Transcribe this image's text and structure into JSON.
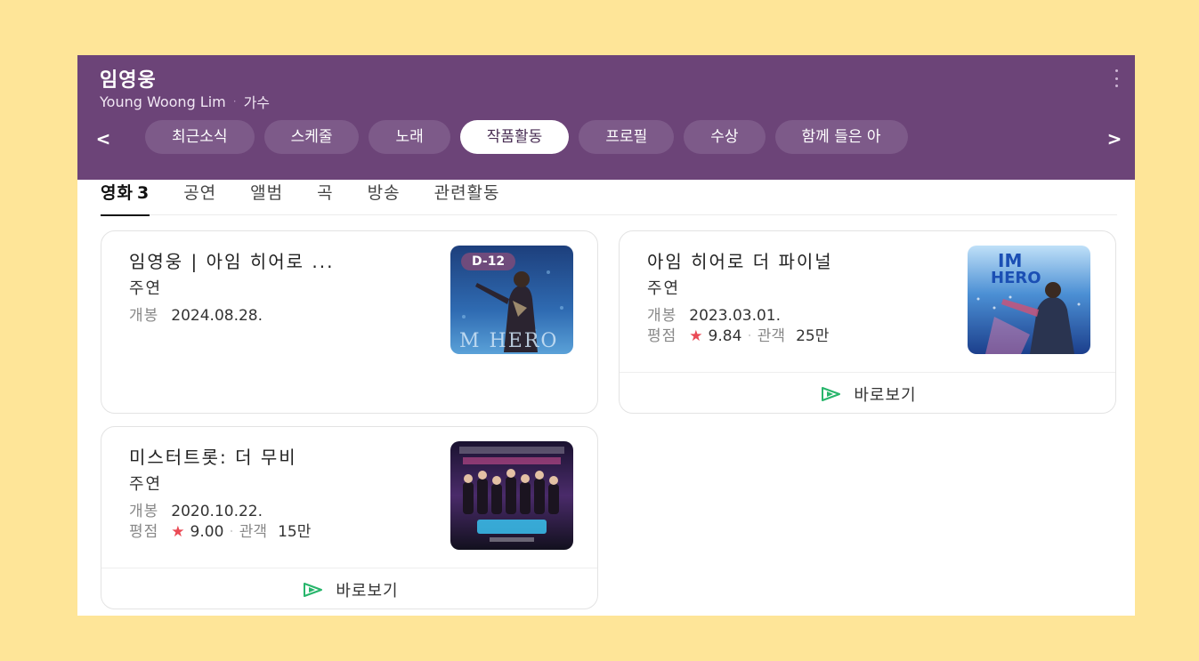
{
  "header": {
    "title": "임영웅",
    "subtitle_name": "Young Woong Lim",
    "subtitle_sep": "·",
    "subtitle_role": "가수",
    "prev_arrow": "<",
    "next_arrow": ">",
    "chips": [
      "최근소식",
      "스케줄",
      "노래",
      "작품활동",
      "프로필",
      "수상",
      "함께 들은 아"
    ],
    "active_chip": "작품활동"
  },
  "tabs": {
    "items": [
      {
        "label": "영화",
        "count": "3",
        "active": true
      },
      {
        "label": "공연"
      },
      {
        "label": "앨범"
      },
      {
        "label": "곡"
      },
      {
        "label": "방송"
      },
      {
        "label": "관련활동"
      }
    ]
  },
  "movies": [
    {
      "title": "임영웅 | 아임 히어로 ...",
      "role": "주연",
      "release_label": "개봉",
      "release_date": "2024.08.28.",
      "badge": "D-12"
    },
    {
      "title": "아임 히어로 더 파이널",
      "role": "주연",
      "release_label": "개봉",
      "release_date": "2023.03.01.",
      "rating_label": "평점",
      "rating_star": "★",
      "rating": "9.84",
      "sep": "·",
      "audience_label": "관객",
      "audience": "25만",
      "watch_label": "바로보기"
    },
    {
      "title": "미스터트롯: 더 무비",
      "role": "주연",
      "release_label": "개봉",
      "release_date": "2020.10.22.",
      "rating_label": "평점",
      "rating_star": "★",
      "rating": "9.00",
      "sep": "·",
      "audience_label": "관객",
      "audience": "15만",
      "watch_label": "바로보기"
    }
  ],
  "colors": {
    "background": "#fee598",
    "header": "#6c4478",
    "accent_green": "#27b56b",
    "star": "#ea4a55"
  }
}
